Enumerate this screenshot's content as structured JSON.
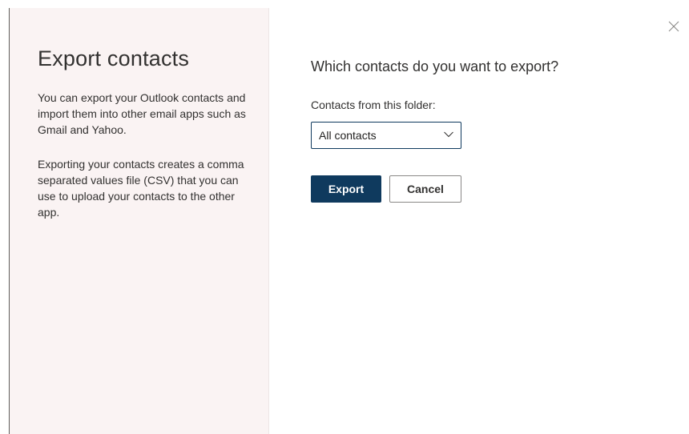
{
  "side_panel": {
    "title": "Export contacts",
    "paragraph_1": "You can export your Outlook contacts and import them into other email apps such as Gmail and Yahoo.",
    "paragraph_2": "Exporting your contacts creates a comma separated values file (CSV) that you can use to upload your contacts to the other app."
  },
  "main": {
    "heading": "Which contacts do you want to export?",
    "folder_label": "Contacts from this folder:",
    "folder_select": {
      "selected": "All contacts",
      "icon": "chevron-down-icon"
    },
    "export_label": "Export",
    "cancel_label": "Cancel"
  },
  "close": {
    "icon": "close-icon"
  },
  "colors": {
    "primary": "#0f3a5e",
    "side_panel_bg": "#faf3f3"
  }
}
